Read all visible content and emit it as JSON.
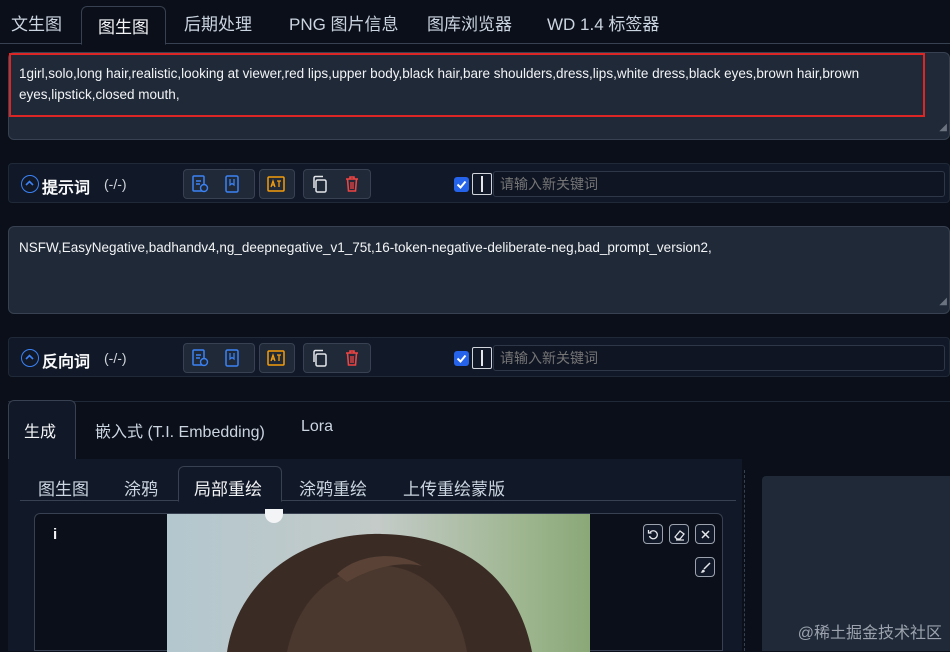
{
  "top_tabs": [
    {
      "label": "文生图"
    },
    {
      "label": "图生图"
    },
    {
      "label": "后期处理"
    },
    {
      "label": "PNG 图片信息"
    },
    {
      "label": "图库浏览器"
    },
    {
      "label": "WD 1.4 标签器"
    }
  ],
  "prompt": {
    "text": "1girl,solo,long hair,realistic,looking at viewer,red lips,upper body,black hair,bare shoulders,dress,lips,white dress,black eyes,brown hair,brown eyes,lipstick,closed mouth,"
  },
  "prompt_row": {
    "title": "提示词",
    "count": "(-/-)",
    "keyword_placeholder": "请输入新关键词"
  },
  "negative_prompt": {
    "text": "NSFW,EasyNegative,badhandv4,ng_deepnegative_v1_75t,16-token-negative-deliberate-neg,bad_prompt_version2,"
  },
  "negative_row": {
    "title": "反向词",
    "count": "(-/-)",
    "keyword_placeholder": "请输入新关键词"
  },
  "gen_tabs": [
    {
      "label": "生成"
    },
    {
      "label": "嵌入式 (T.I. Embedding)"
    },
    {
      "label": "Lora"
    }
  ],
  "img_tabs": [
    {
      "label": "图生图"
    },
    {
      "label": "涂鸦"
    },
    {
      "label": "局部重绘"
    },
    {
      "label": "涂鸦重绘"
    },
    {
      "label": "上传重绘蒙版"
    }
  ],
  "canvas": {
    "info_label": "i"
  },
  "watermark": "@稀土掘金技术社区",
  "colors": {
    "accent": "#3b82f6",
    "highlight_border": "#dc2626",
    "danger": "#ef4444",
    "warning": "#f59e0b"
  }
}
